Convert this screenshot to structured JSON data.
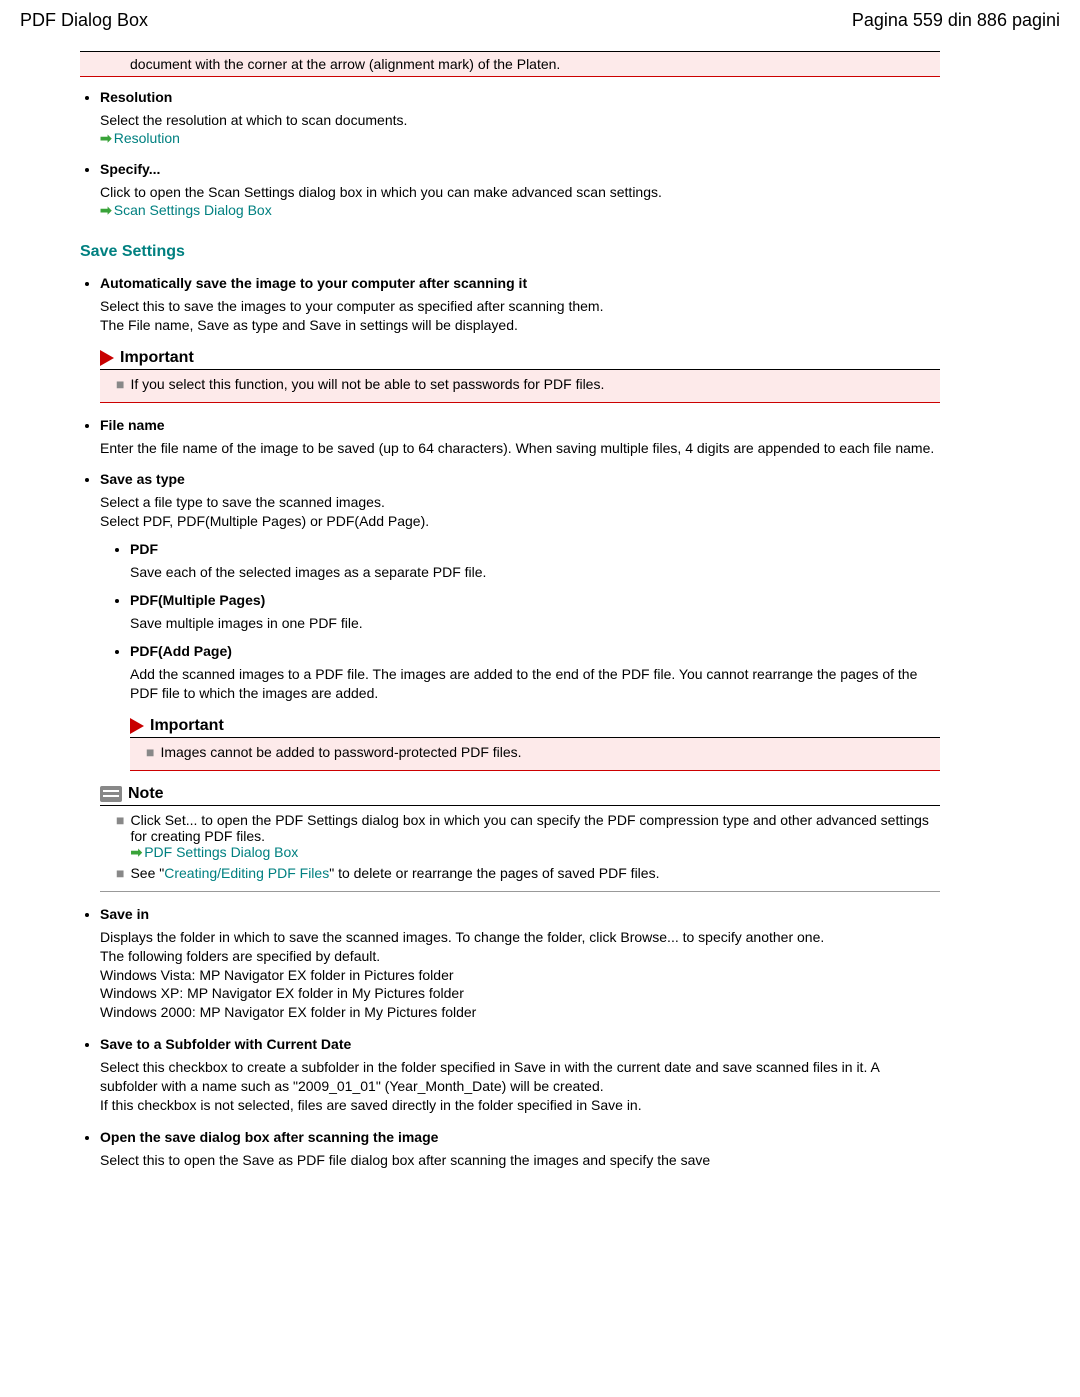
{
  "header": {
    "title": "PDF Dialog Box",
    "page_info": "Pagina 559 din 886 pagini"
  },
  "topnote": "document with the corner at the arrow (alignment mark) of the Platen.",
  "items1": {
    "resolution": {
      "title": "Resolution",
      "desc": "Select the resolution at which to scan documents.",
      "link": "Resolution"
    },
    "specify": {
      "title": "Specify...",
      "desc": "Click to open the Scan Settings dialog box in which you can make advanced scan settings.",
      "link": "Scan Settings Dialog Box"
    }
  },
  "save_settings_heading": "Save Settings",
  "items2": {
    "auto_save": {
      "title": "Automatically save the image to your computer after scanning it",
      "desc1": "Select this to save the images to your computer as specified after scanning them.",
      "desc2": "The File name, Save as type and Save in settings will be displayed.",
      "important_label": "Important",
      "important_text": "If you select this function, you will not be able to set passwords for PDF files."
    },
    "file_name": {
      "title": "File name",
      "desc": "Enter the file name of the image to be saved (up to 64 characters). When saving multiple files, 4 digits are appended to each file name."
    },
    "save_as_type": {
      "title": "Save as type",
      "desc1": "Select a file type to save the scanned images.",
      "desc2": "Select PDF, PDF(Multiple Pages) or PDF(Add Page).",
      "pdf": {
        "title": "PDF",
        "desc": "Save each of the selected images as a separate PDF file."
      },
      "pdf_multi": {
        "title": "PDF(Multiple Pages)",
        "desc": "Save multiple images in one PDF file."
      },
      "pdf_add": {
        "title": "PDF(Add Page)",
        "desc": "Add the scanned images to a PDF file. The images are added to the end of the PDF file. You cannot rearrange the pages of the PDF file to which the images are added."
      },
      "important_label": "Important",
      "important_text": "Images cannot be added to password-protected PDF files.",
      "note_label": "Note",
      "note_text1": "Click Set... to open the PDF Settings dialog box in which you can specify the PDF compression type and other advanced settings for creating PDF files.",
      "note_link1": "PDF Settings Dialog Box",
      "note_text2a": "See \"",
      "note_link2": "Creating/Editing PDF Files",
      "note_text2b": "\" to delete or rearrange the pages of saved PDF files."
    },
    "save_in": {
      "title": "Save in",
      "l1": "Displays the folder in which to save the scanned images. To change the folder, click Browse... to specify another one.",
      "l2": "The following folders are specified by default.",
      "l3": "Windows Vista: MP Navigator EX folder in Pictures folder",
      "l4": "Windows XP: MP Navigator EX folder in My Pictures folder",
      "l5": "Windows 2000: MP Navigator EX folder in My Pictures folder"
    },
    "save_subfolder": {
      "title": "Save to a Subfolder with Current Date",
      "l1": "Select this checkbox to create a subfolder in the folder specified in Save in with the current date and save scanned files in it. A subfolder with a name such as \"2009_01_01\" (Year_Month_Date) will be created.",
      "l2": "If this checkbox is not selected, files are saved directly in the folder specified in Save in."
    },
    "open_save_dialog": {
      "title": "Open the save dialog box after scanning the image",
      "desc": "Select this to open the Save as PDF file dialog box after scanning the images and specify the save"
    }
  }
}
